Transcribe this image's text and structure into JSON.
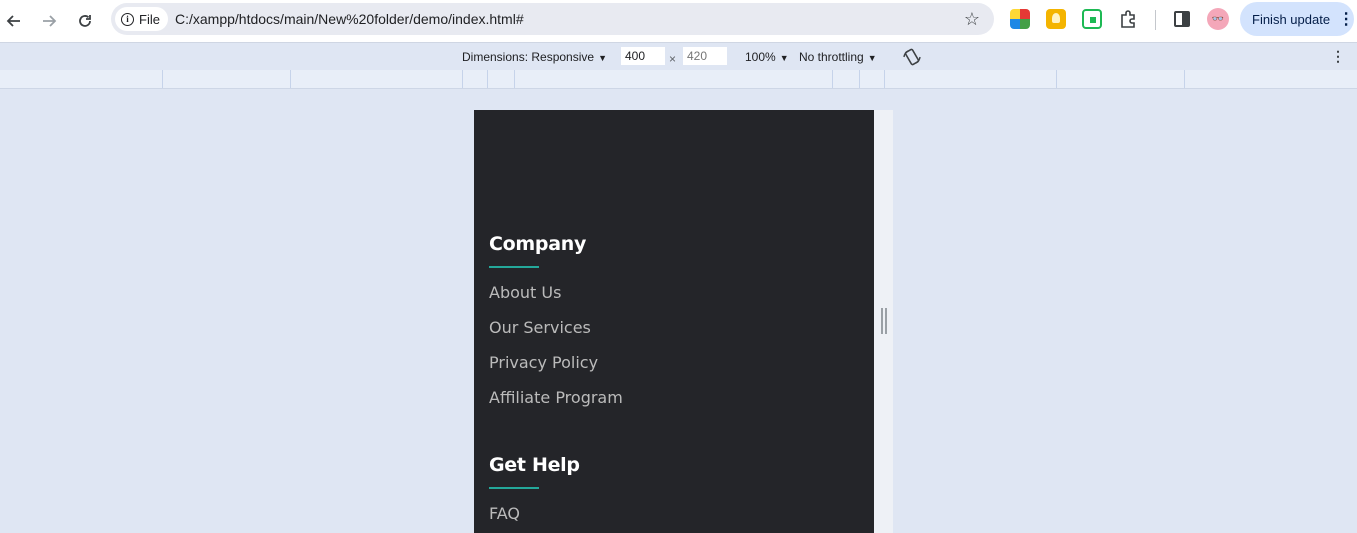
{
  "browser": {
    "file_label": "File",
    "url": "C:/xampp/htdocs/main/New%20folder/demo/index.html#",
    "finish_update_label": "Finish update",
    "kebab_label": "⋮"
  },
  "devtools": {
    "dimensions_label": "Dimensions: Responsive",
    "width_value": "400",
    "height_value": "420",
    "times": "×",
    "zoom_label": "100%",
    "throttle_label": "No throttling",
    "more_label": "⋮"
  },
  "footer": {
    "company": {
      "title": "Company",
      "links": [
        "About Us",
        "Our Services",
        "Privacy Policy",
        "Affiliate Program"
      ]
    },
    "help": {
      "title": "Get Help",
      "links": [
        "FAQ"
      ]
    }
  },
  "colors": {
    "footer_bg": "#242529",
    "accent_underline": "#24a89a",
    "devtools_bg": "#dfe6f3"
  }
}
